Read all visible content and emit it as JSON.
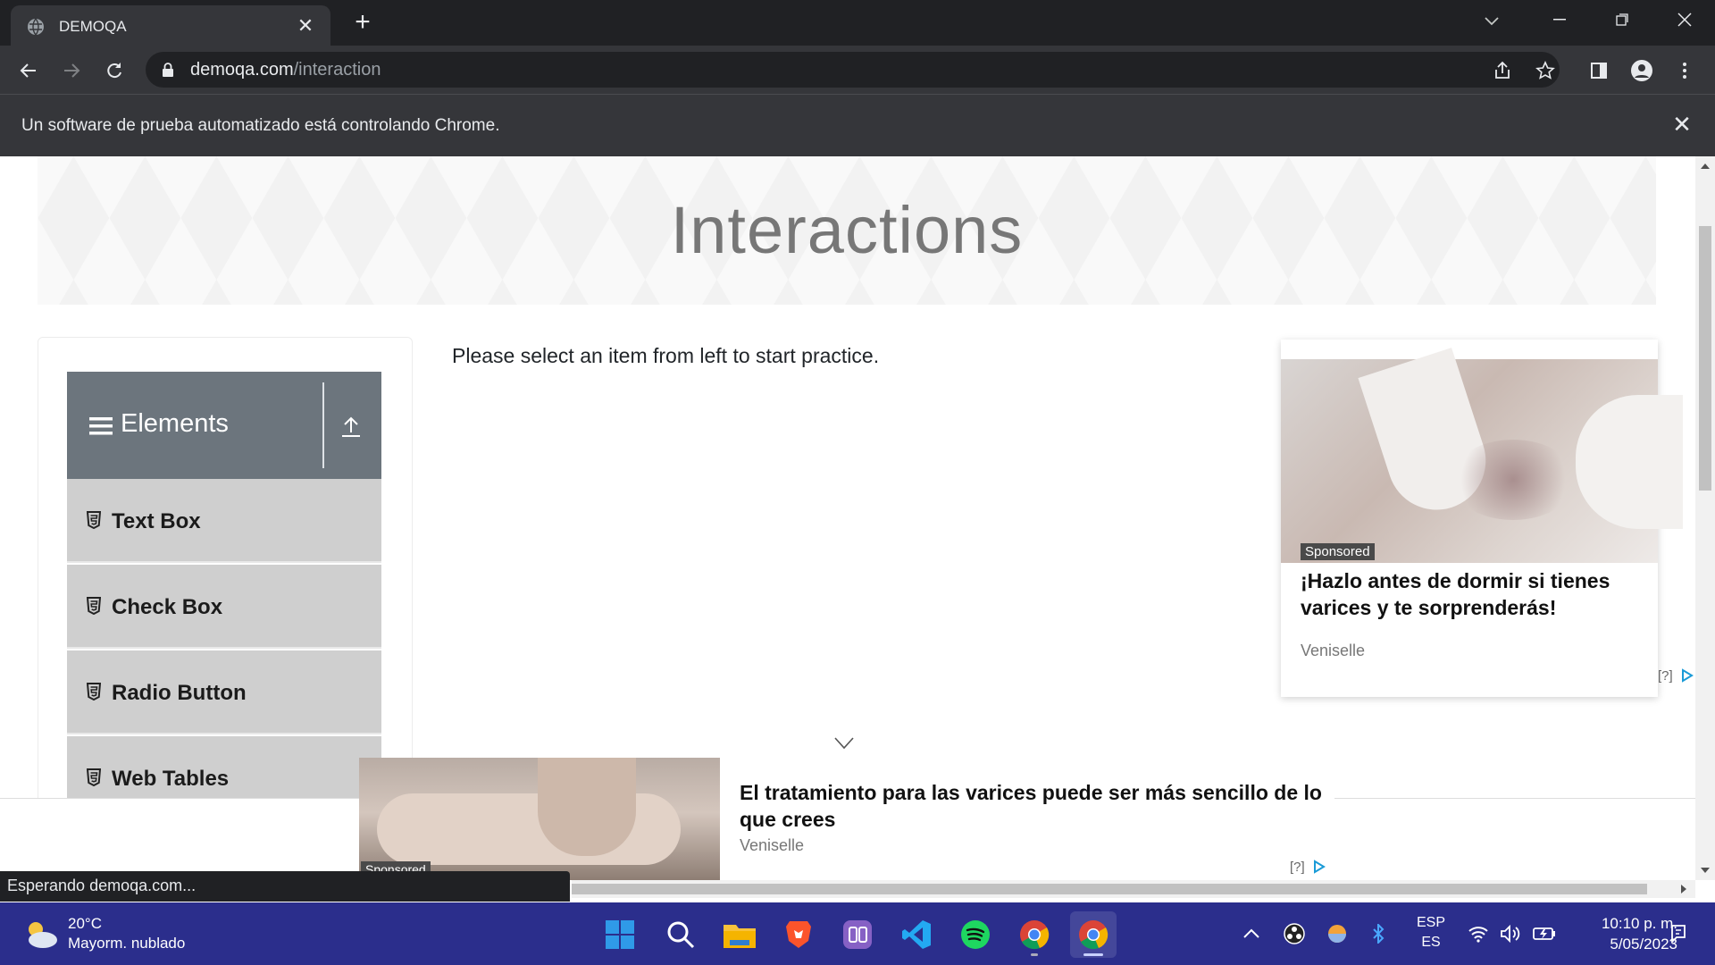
{
  "browser": {
    "tab_title": "DEMOQA",
    "url_host": "demoqa.com",
    "url_path": "/interaction",
    "infobar_message": "Un software de prueba automatizado está controlando Chrome.",
    "status_text": "Esperando demoqa.com..."
  },
  "page": {
    "title": "Interactions",
    "practice_message": "Please select an item from left to start practice."
  },
  "sidebar": {
    "group_title": "Elements",
    "items": [
      {
        "label": "Text Box"
      },
      {
        "label": "Check Box"
      },
      {
        "label": "Radio Button"
      },
      {
        "label": "Web Tables"
      }
    ]
  },
  "ads": {
    "right": {
      "tag": "Sponsored",
      "headline": "¡Hazlo antes de dormir si tienes varices y te sorprenderás!",
      "source": "Veniselle",
      "help": "[?]"
    },
    "bottom": {
      "tag": "Sponsored",
      "headline": "El tratamiento para las varices puede ser más sencillo de lo que crees",
      "source": "Veniselle",
      "help": "[?]"
    }
  },
  "taskbar": {
    "weather_temp": "20°C",
    "weather_condition": "Mayorm. nublado",
    "lang_primary": "ESP",
    "lang_secondary": "ES",
    "time": "10:10 p. m.",
    "date": "5/05/2023",
    "apps": [
      "start",
      "search",
      "file-explorer",
      "brave",
      "app-purple",
      "vscode",
      "spotify",
      "chrome",
      "chrome-active"
    ]
  },
  "colors": {
    "chrome_dark": "#202124",
    "chrome_toolbar": "#35363a",
    "group_header": "#6c757d",
    "menu_item": "#cfcfcf",
    "taskbar": "#2b2e8c"
  }
}
